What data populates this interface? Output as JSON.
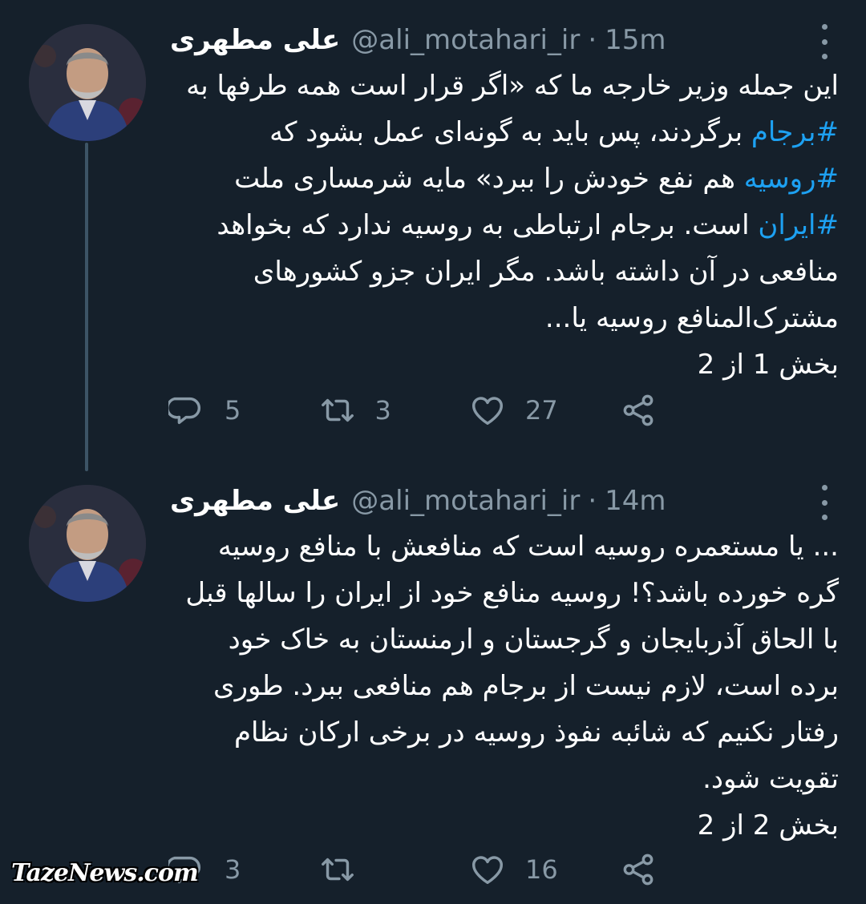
{
  "colors": {
    "background": "#15202b",
    "text": "#ffffff",
    "secondary": "#8899a6",
    "hashtag": "#1da1f2",
    "thread_line": "#3d5466"
  },
  "tweets": [
    {
      "author_name": "علی مطهری",
      "handle": "@ali_motahari_ir",
      "separator": "·",
      "time": "15m",
      "lines": [
        [
          {
            "t": "این جمله وزیر خارجه ما که «اگر قرار است همه طرفها به"
          }
        ],
        [
          {
            "t": "#برجام",
            "tag": true
          },
          {
            "t": " برگردند، پس باید به گونه‌ای عمل بشود که"
          }
        ],
        [
          {
            "t": "#روسیه",
            "tag": true
          },
          {
            "t": " هم نفع خودش را ببرد» مایه شرمساری ملت"
          }
        ],
        [
          {
            "t": "#ایران",
            "tag": true
          },
          {
            "t": " است. برجام ارتباطی به روسیه ندارد که بخواهد"
          }
        ],
        [
          {
            "t": "منافعی در آن داشته باشد. مگر ایران جزو کشورهای"
          }
        ],
        [
          {
            "t": "مشترک‌المنافع روسیه یا..."
          }
        ],
        [
          {
            "t": "بخش 1 از 2"
          }
        ]
      ],
      "replies": "5",
      "retweets": "3",
      "likes": "27",
      "icons": [
        "reply-icon",
        "retweet-icon",
        "like-icon",
        "share-icon"
      ]
    },
    {
      "author_name": "علی مطهری",
      "handle": "@ali_motahari_ir",
      "separator": "·",
      "time": "14m",
      "lines": [
        [
          {
            "t": "... یا مستعمره روسیه است که منافعش با منافع روسیه"
          }
        ],
        [
          {
            "t": "گره خورده باشد؟! روسیه منافع خود از ایران را سالها قبل"
          }
        ],
        [
          {
            "t": "با الحاق آذربایجان و گرجستان و ارمنستان به خاک خود"
          }
        ],
        [
          {
            "t": "برده است، لازم نیست از برجام هم منافعی ببرد. طوری"
          }
        ],
        [
          {
            "t": "رفتار نکنیم که شائبه نفوذ روسیه در برخی ارکان نظام"
          }
        ],
        [
          {
            "t": "تقویت شود."
          }
        ],
        [
          {
            "t": "بخش 2 از 2"
          }
        ]
      ],
      "replies": "3",
      "retweets": "",
      "likes": "16",
      "icons": [
        "reply-icon",
        "retweet-icon",
        "like-icon",
        "share-icon"
      ]
    }
  ],
  "watermark": "TazeNews.com"
}
